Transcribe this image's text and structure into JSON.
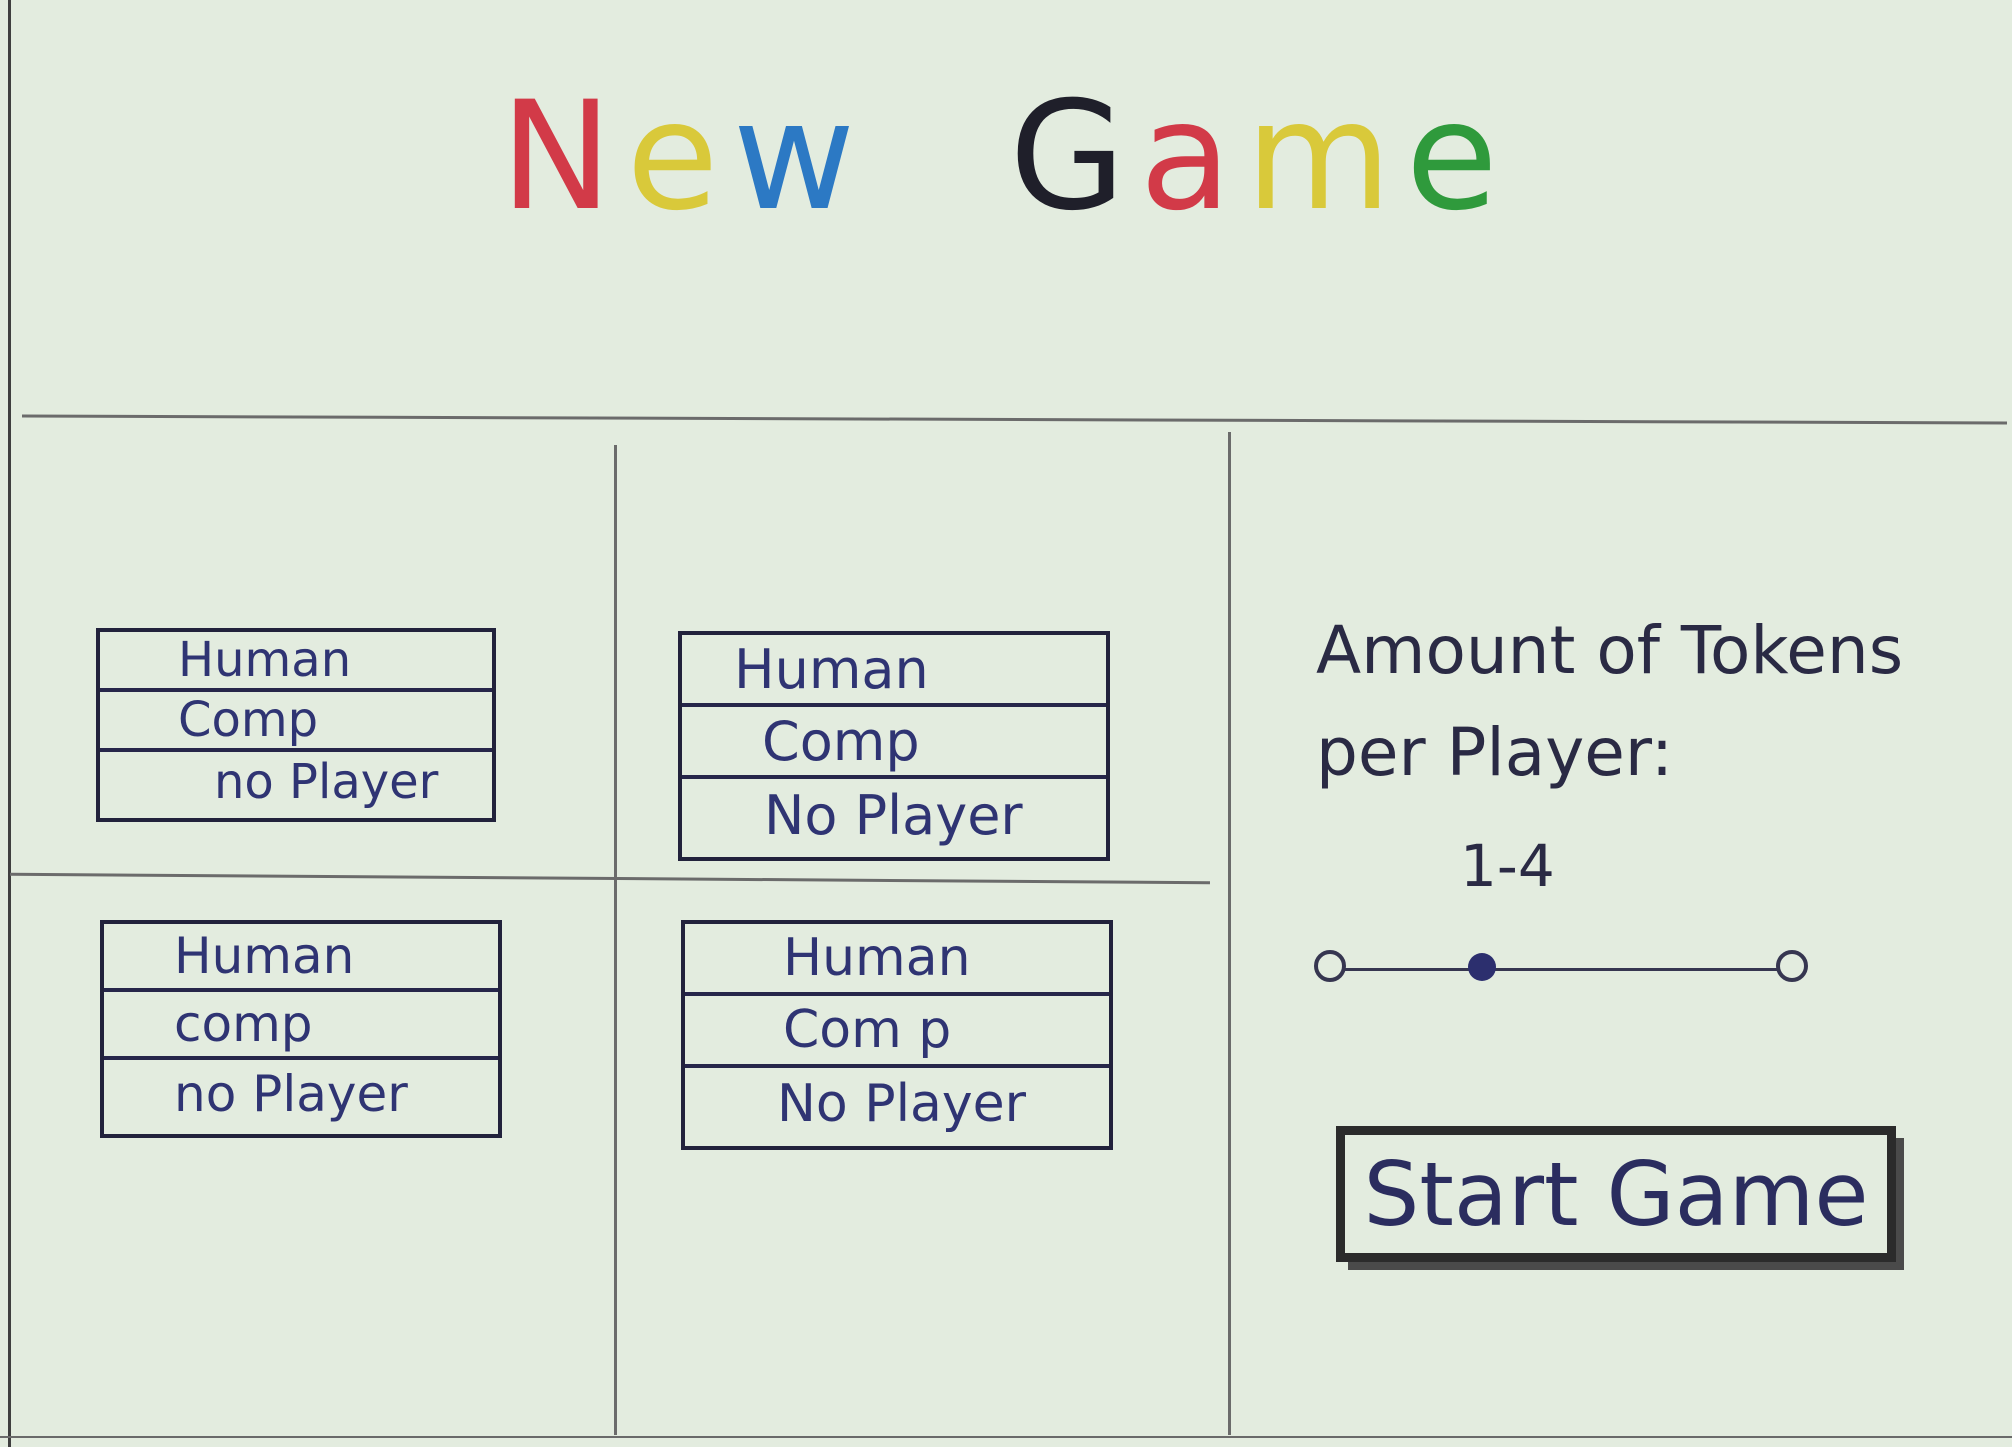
{
  "title": {
    "word1": "New",
    "word2": "Game",
    "colors": [
      "#1f1f2a",
      "#d23a48",
      "#d9c93a",
      "#2f9a3c",
      "#2c79c4"
    ]
  },
  "player_slots": [
    {
      "options": [
        "Human",
        "Comp",
        "no Player"
      ]
    },
    {
      "options": [
        "Human",
        "Comp",
        "No Player"
      ]
    },
    {
      "options": [
        "Human",
        "comp",
        "no Player"
      ]
    },
    {
      "options": [
        "Human",
        "Com p",
        "No Player"
      ]
    }
  ],
  "tokens": {
    "label_line1": "Amount of Tokens",
    "label_line2": "per Player:",
    "range_text": "1-4",
    "slider_min": 1,
    "slider_max": 4,
    "slider_value": 2
  },
  "start_button_label": "Start Game"
}
